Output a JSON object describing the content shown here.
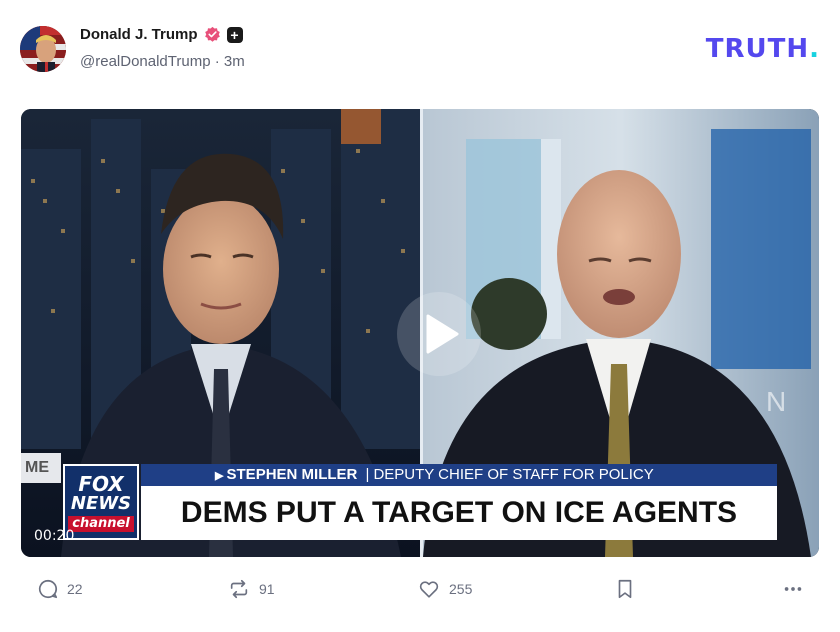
{
  "post": {
    "author_name": "Donald J. Trump",
    "handle": "@realDonaldTrump",
    "time_ago": "3m",
    "separator": "·"
  },
  "brand": {
    "text": "TRUTH",
    "dot": ".",
    "primary_color": "#5448ee",
    "dot_color": "#17d2e0"
  },
  "video": {
    "timestamp": "00:20",
    "network_logo_line1": "FOX",
    "network_logo_line2": "NEWS",
    "network_logo_line3": "channel",
    "lower_third_name": "STEPHEN MILLER",
    "lower_third_divider": "|",
    "lower_third_title": "DEPUTY CHIEF OF STAFF FOR POLICY",
    "headline": "DEMS PUT A TARGET ON ICE AGENTS",
    "bug_text": "ME"
  },
  "actions": {
    "replies": "22",
    "retruths": "91",
    "likes": "255"
  },
  "icons": [
    "verified-badge-icon",
    "plus-badge-icon",
    "play-icon",
    "reply-icon",
    "retruth-icon",
    "like-icon",
    "bookmark-icon",
    "more-icon"
  ]
}
